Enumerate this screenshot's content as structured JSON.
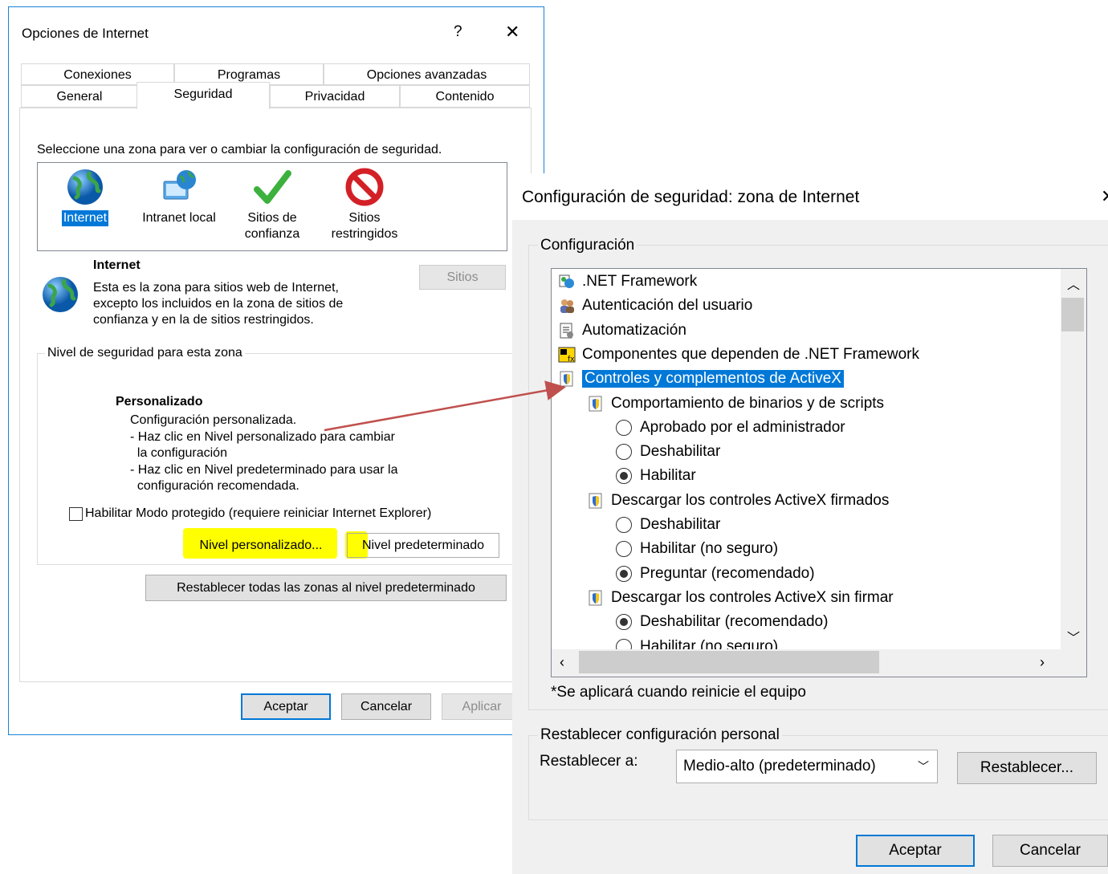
{
  "dlg1": {
    "title": "Opciones de Internet",
    "help": "?",
    "close": "✕",
    "tabs_top": [
      "Conexiones",
      "Programas",
      "Opciones avanzadas"
    ],
    "tabs_bottom": [
      "General",
      "Seguridad",
      "Privacidad",
      "Contenido"
    ],
    "select_zone_text": "Seleccione una zona para ver o cambiar la configuración de seguridad.",
    "zones": [
      {
        "label": "Internet",
        "icon": "globe-icon",
        "selected": true
      },
      {
        "label": "Intranet local",
        "icon": "intranet-icon"
      },
      {
        "label": "Sitios de\nconfianza",
        "icon": "check-icon"
      },
      {
        "label": "Sitios\nrestringidos",
        "icon": "restricted-icon"
      }
    ],
    "zone_title": "Internet",
    "zone_desc": "Esta es la zona para sitios web de Internet,\nexcepto los incluidos en la zona de sitios de\nconfianza y en la de sitios restringidos.",
    "sitios_button": "Sitios",
    "level_group_title": "Nivel de seguridad para esta zona",
    "level_title": "Personalizado",
    "level_desc": "Configuración personalizada.\n- Haz clic en Nivel personalizado para cambiar\n  la configuración\n- Haz clic en Nivel predeterminado para usar la\n  configuración recomendada.",
    "protected_mode": "Habilitar Modo protegido (requiere reiniciar Internet Explorer)",
    "custom_level_button": "Nivel personalizado...",
    "default_level_button": "Nivel predeterminado",
    "reset_all_button": "Restablecer todas las zonas al nivel predeterminado",
    "ok": "Aceptar",
    "cancel": "Cancelar",
    "apply": "Aplicar"
  },
  "dlg2": {
    "title": "Configuración de seguridad: zona de Internet",
    "config_group": "Configuración",
    "tree": [
      {
        "type": "node",
        "label": ".NET Framework",
        "icon": "net-icon",
        "indent": 0
      },
      {
        "type": "node",
        "label": "Autenticación del usuario",
        "icon": "users-icon",
        "indent": 0
      },
      {
        "type": "node",
        "label": "Automatización",
        "icon": "script-icon",
        "indent": 0
      },
      {
        "type": "node",
        "label": "Componentes que dependen de .NET Framework",
        "icon": "net-components-icon",
        "indent": 0
      },
      {
        "type": "node",
        "label": "Controles y complementos de ActiveX",
        "icon": "shield-doc-icon",
        "indent": 0,
        "selected": true
      },
      {
        "type": "node",
        "label": "Comportamiento de binarios y de scripts",
        "icon": "shield-doc-icon",
        "indent": 1
      },
      {
        "type": "radio",
        "label": "Aprobado por el administrador",
        "checked": false,
        "indent": 2
      },
      {
        "type": "radio",
        "label": "Deshabilitar",
        "checked": false,
        "indent": 2
      },
      {
        "type": "radio",
        "label": "Habilitar",
        "checked": true,
        "indent": 2
      },
      {
        "type": "node",
        "label": "Descargar los controles ActiveX firmados",
        "icon": "shield-doc-icon",
        "indent": 1
      },
      {
        "type": "radio",
        "label": "Deshabilitar",
        "checked": false,
        "indent": 2
      },
      {
        "type": "radio",
        "label": "Habilitar (no seguro)",
        "checked": false,
        "indent": 2
      },
      {
        "type": "radio",
        "label": "Preguntar (recomendado)",
        "checked": true,
        "indent": 2
      },
      {
        "type": "node",
        "label": "Descargar los controles ActiveX sin firmar",
        "icon": "shield-doc-icon",
        "indent": 1
      },
      {
        "type": "radio",
        "label": "Deshabilitar (recomendado)",
        "checked": true,
        "indent": 2
      },
      {
        "type": "radio",
        "label": "Habilitar (no seguro)",
        "checked": false,
        "indent": 2
      }
    ],
    "restart_note": "*Se aplicará cuando reinicie el equipo",
    "reset_group": "Restablecer configuración personal",
    "reset_to_label": "Restablecer a:",
    "reset_select_value": "Medio-alto (predeterminado)",
    "reset_button": "Restablecer...",
    "ok": "Aceptar",
    "cancel": "Cancelar"
  },
  "colors": {
    "selection": "#0078d7",
    "highlight": "#ffff00",
    "arrow": "#c0504d"
  }
}
